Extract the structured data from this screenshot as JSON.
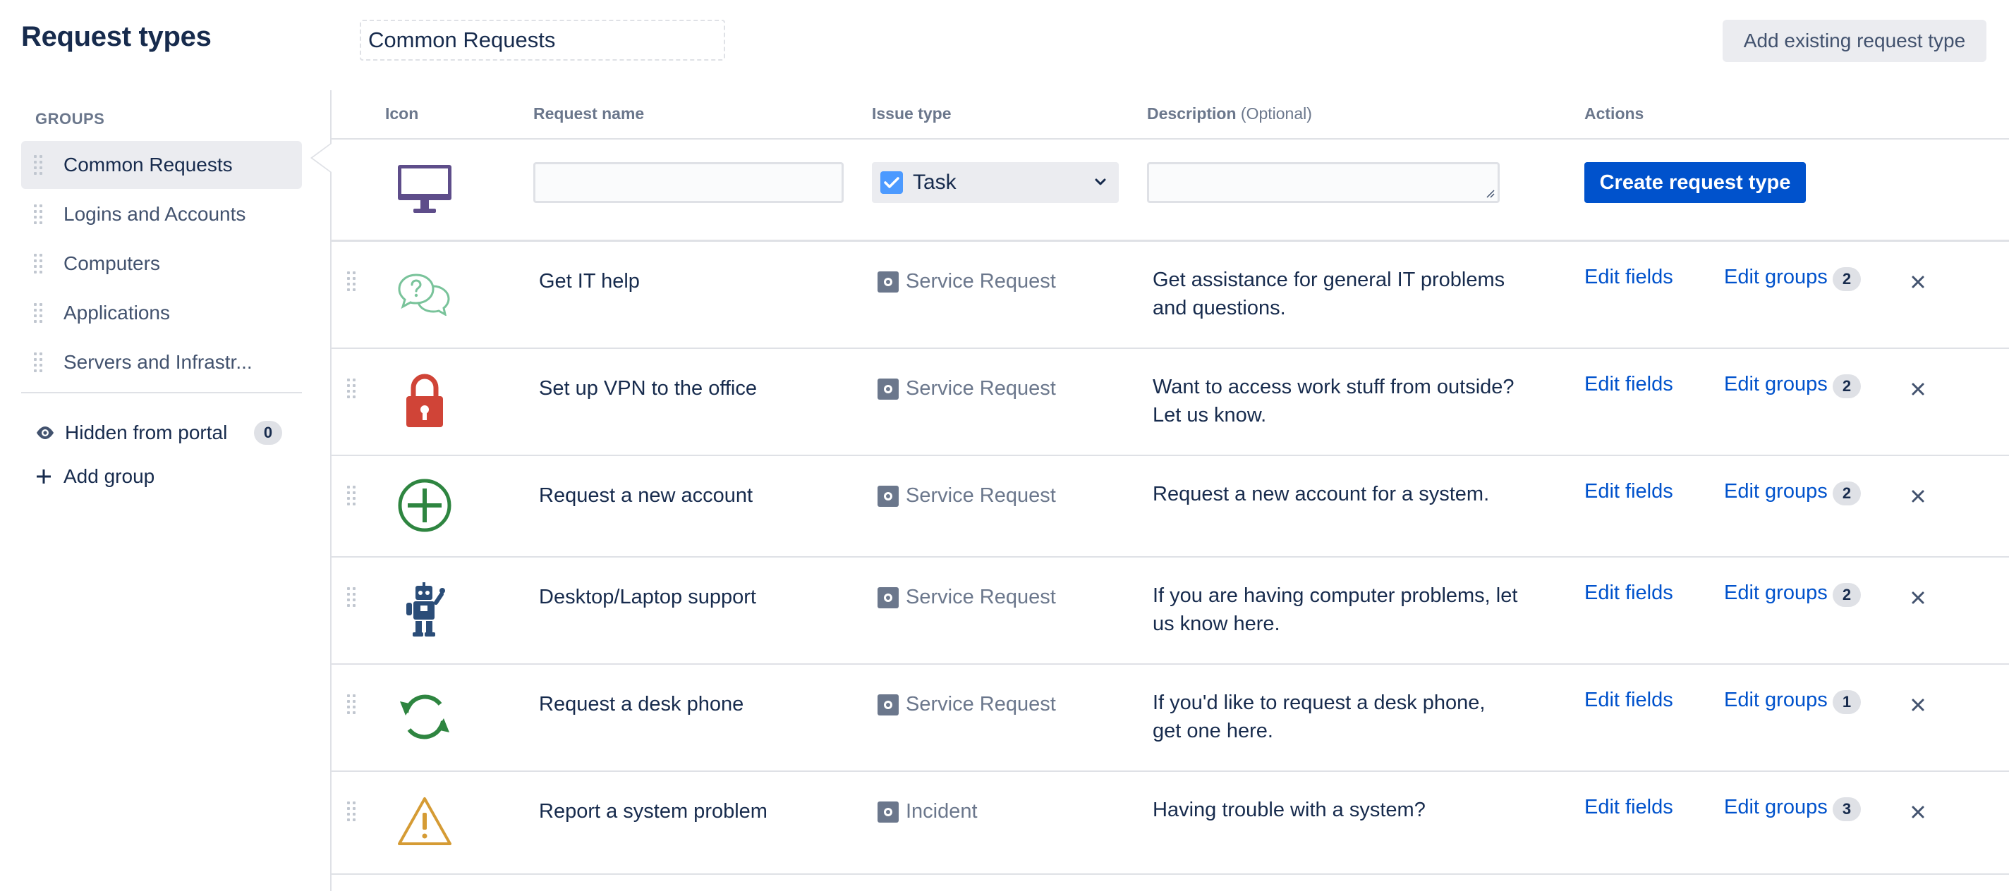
{
  "header": {
    "title": "Request types",
    "group_name_value": "Common Requests",
    "add_existing_label": "Add existing request type"
  },
  "sidebar": {
    "groups_heading": "GROUPS",
    "items": [
      {
        "label": "Common Requests",
        "active": true
      },
      {
        "label": "Logins and Accounts"
      },
      {
        "label": "Computers"
      },
      {
        "label": "Applications"
      },
      {
        "label": "Servers and Infrastr..."
      }
    ],
    "hidden_label": "Hidden from portal",
    "hidden_count": "0",
    "add_group_label": "Add group"
  },
  "table": {
    "columns": {
      "icon": "Icon",
      "name": "Request name",
      "issue_type": "Issue type",
      "description": "Description",
      "description_optional": "(Optional)",
      "actions": "Actions"
    },
    "new_row": {
      "name_value": "",
      "issue_type": "Task",
      "description_value": "",
      "create_label": "Create request type"
    },
    "edit_fields_label": "Edit fields",
    "edit_groups_label": "Edit groups",
    "rows": [
      {
        "icon": "chat-question-icon",
        "name": "Get IT help",
        "issue_type": "Service Request",
        "desc1": "Get assistance for general IT problems",
        "desc2": "and questions.",
        "groups": "2"
      },
      {
        "icon": "padlock-icon",
        "name": "Set up VPN to the office",
        "issue_type": "Service Request",
        "desc1": "Want to access work stuff from outside?",
        "desc2": "Let us know.",
        "groups": "2"
      },
      {
        "icon": "plus-circle-icon",
        "name": "Request a new account",
        "issue_type": "Service Request",
        "desc1": "Request a new account for a system.",
        "desc2": "",
        "groups": "2"
      },
      {
        "icon": "robot-icon",
        "name": "Desktop/Laptop support",
        "issue_type": "Service Request",
        "desc1": "If you are having computer problems, let",
        "desc2": "us know here.",
        "groups": "2"
      },
      {
        "icon": "refresh-arrows-icon",
        "name": "Request a desk phone",
        "issue_type": "Service Request",
        "desc1": "If you'd like to request a desk phone,",
        "desc2": "get one here.",
        "groups": "1"
      },
      {
        "icon": "warning-triangle-icon",
        "name": "Report a system problem",
        "issue_type": "Incident",
        "desc1": "Having trouble with a system?",
        "desc2": "",
        "groups": "3"
      }
    ]
  },
  "colors": {
    "primary_button": "#0052cc",
    "link": "#0052cc",
    "heading": "#172b4d",
    "muted": "#6b778c"
  }
}
